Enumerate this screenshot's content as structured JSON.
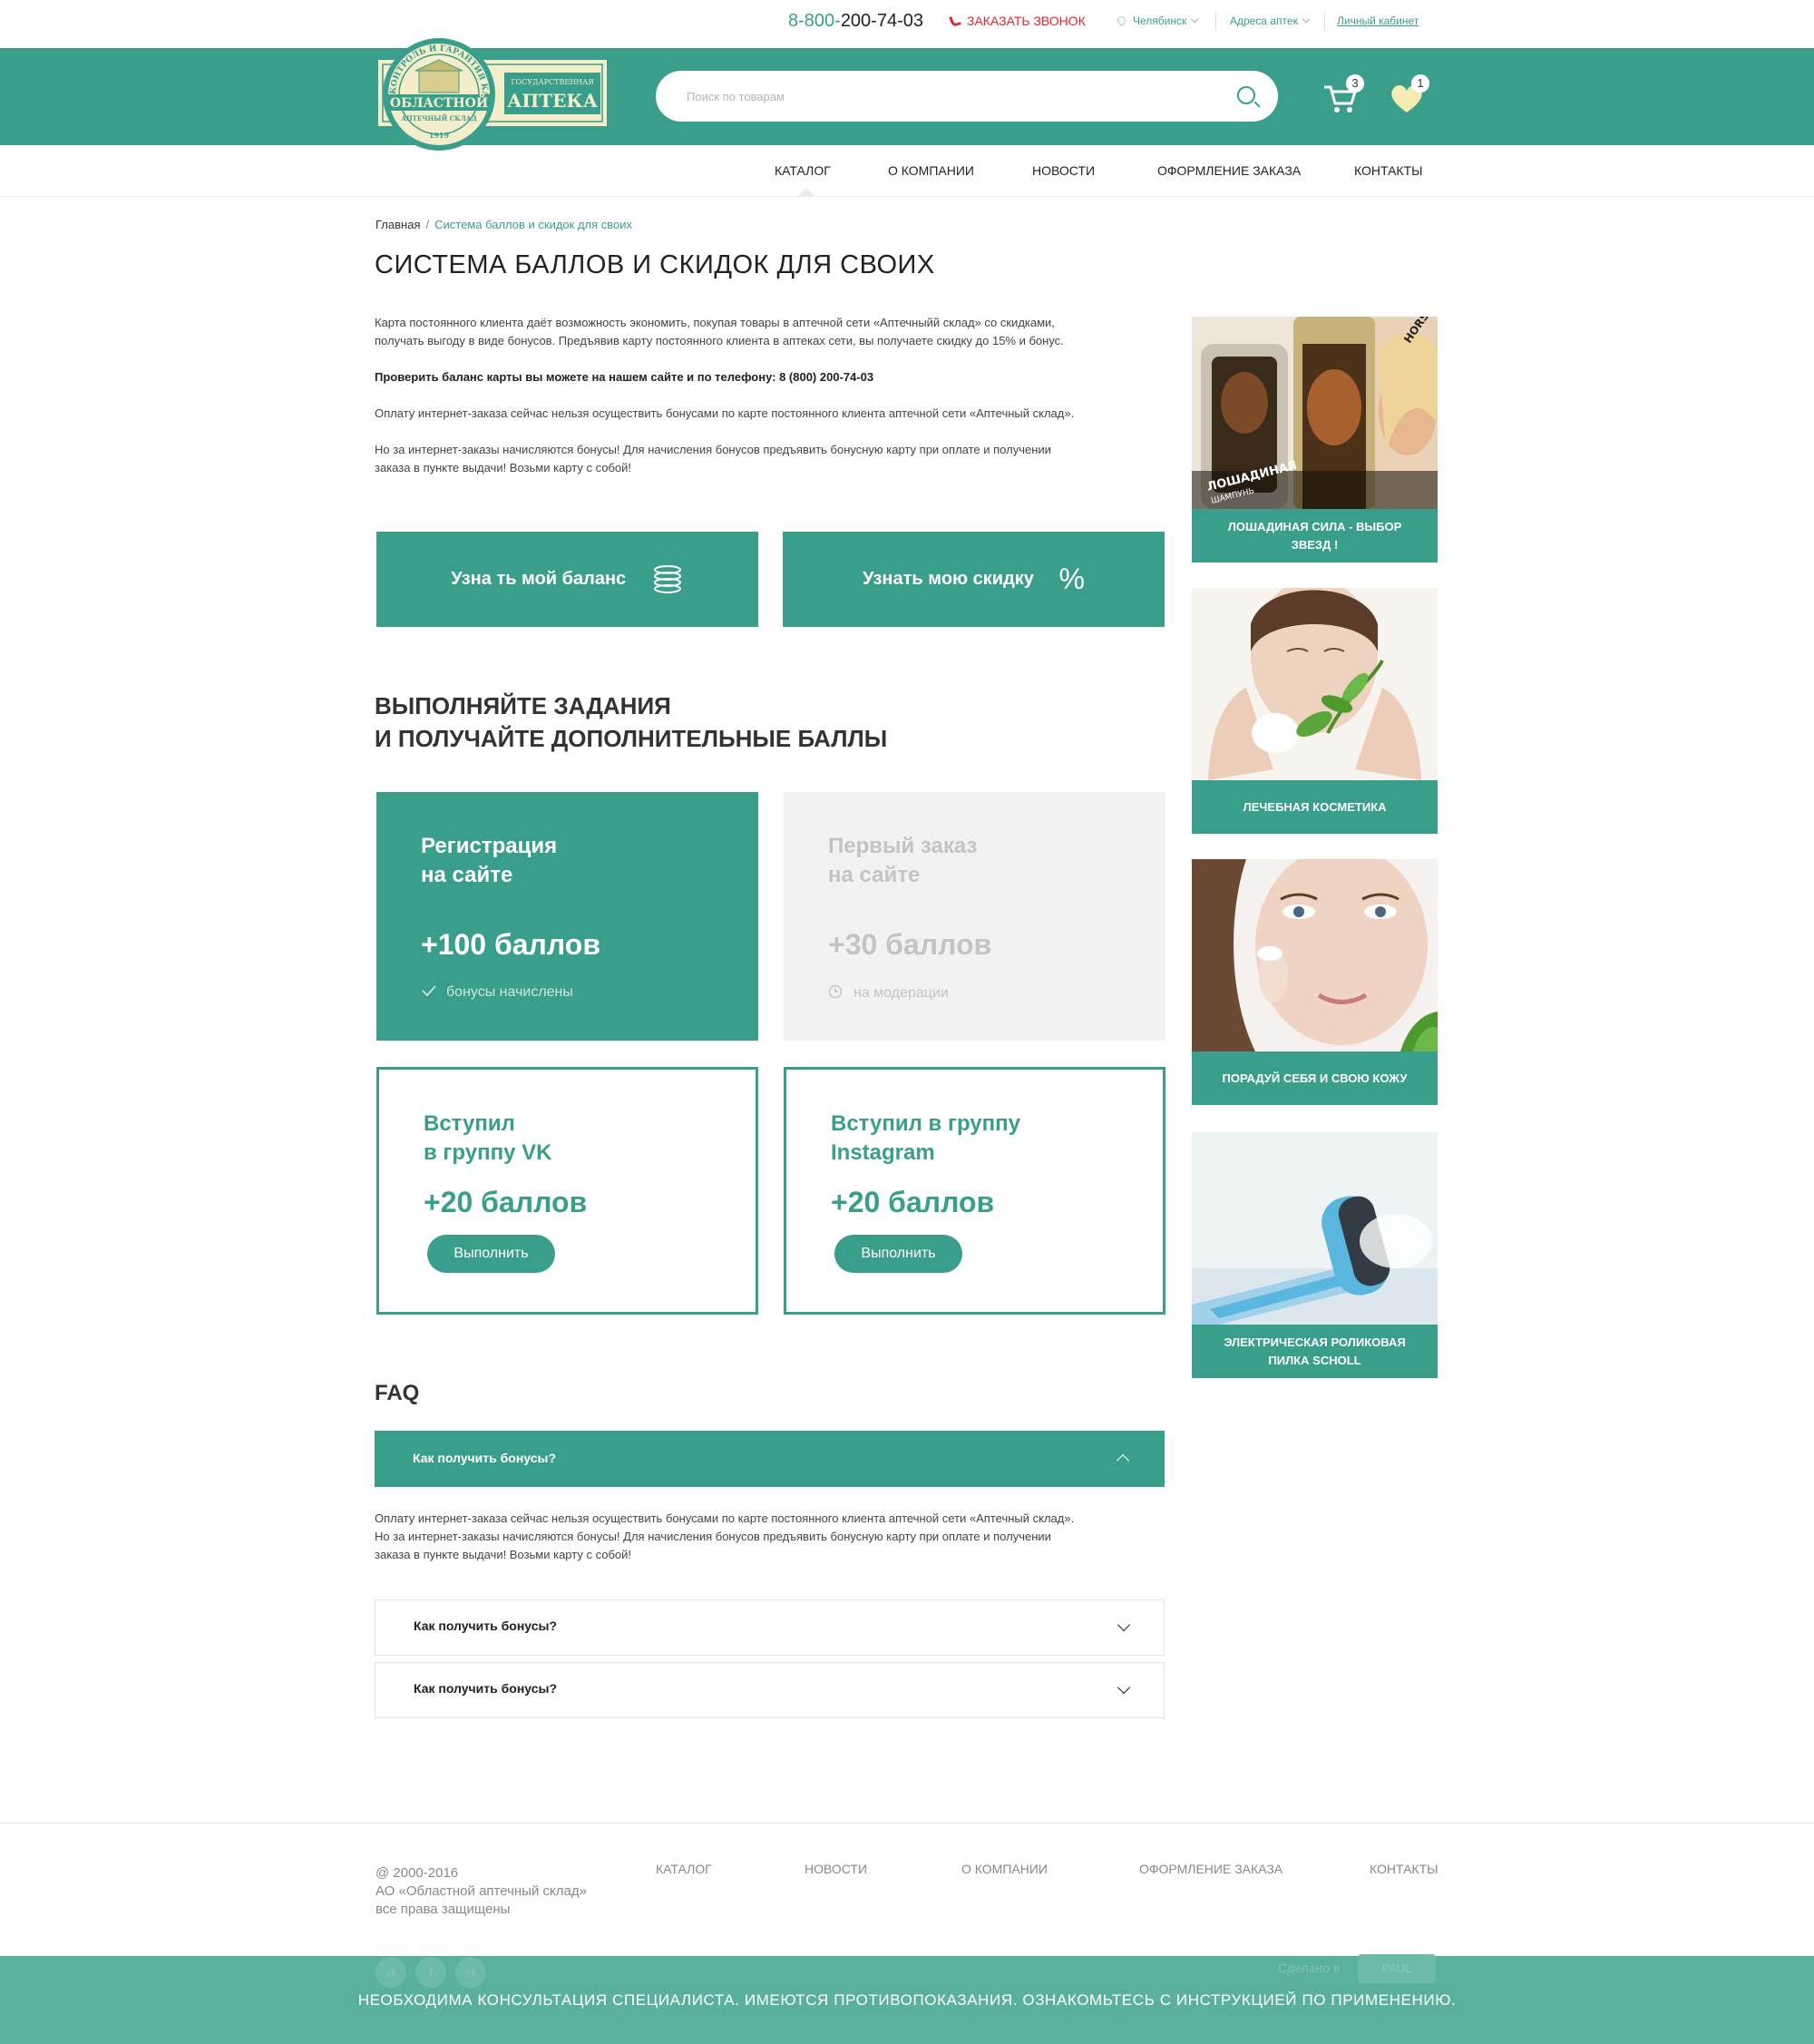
{
  "topbar": {
    "phone_prefix": "8-800-",
    "phone_rest": "200-74-03",
    "callback": "ЗАКАЗАТЬ ЗВОНОК",
    "city": "Челябинск",
    "addresses": "Адреса аптек",
    "cabinet": "Личный кабинет"
  },
  "header": {
    "search_placeholder": "Поиск по товарам",
    "cart_count": "3",
    "fav_count": "1",
    "colors": {
      "accent": "#3a9e8c",
      "danger": "#e0262c"
    },
    "logo": {
      "ring_text": "КОНТРОЛЬ И ГАРАНТИЯ КАЧЕСТВА",
      "ribbon": "ОБЛАСТНОЙ",
      "sub": "АПТЕЧНЫЙ СКЛАД",
      "year": "1919",
      "state": "ГОСУДАРСТВЕННАЯ",
      "pharmacy": "АПТЕКА"
    }
  },
  "nav": {
    "items": [
      "КАТАЛОГ",
      "О КОМПАНИИ",
      "НОВОСТИ",
      "ОФОРМЛЕНИЕ ЗАКАЗА",
      "КОНТАКТЫ"
    ]
  },
  "breadcrumb": {
    "home": "Главная",
    "current": "Система баллов и скидок для своих"
  },
  "page": {
    "title": "СИСТЕМА БАЛЛОВ И СКИДОК ДЛЯ СВОИХ",
    "p1_line1": "Карта постоянного клиента даёт возможность экономить, покупая товары в аптечной сети «Аптечныйй склад» со скидками,",
    "p1_line2": "получать выгоду в виде бонусов. Предъявив карту постоянного клиента в аптеках сети, вы получаете скидку до 15% и бонус.",
    "p2": "Проверить баланс карты вы можете на нашем сайте и по телефону: 8 (800) 200-74-03",
    "p3": "Оплату интернет-заказа сейчас нельзя осуществить бонусами по карте постоянного клиента аптечной сети «Аптечный склад».",
    "p4_line1": "Но за интернет-заказы начисляются бонусы! Для начисления бонусов предъявить бонусную карту при оплате и получении",
    "p4_line2": "заказа в пункте выдачи! Возьми карту с собой!"
  },
  "actions": {
    "balance": "Узна ть мой баланс",
    "discount": "Узнать мою скидку",
    "percent": "%"
  },
  "tasks": {
    "heading_line1": "ВЫПОЛНЯЙТЕ ЗАДАНИЯ",
    "heading_line2": "И ПОЛУЧАЙТЕ ДОПОЛНИТЕЛЬНЫЕ БАЛЛЫ",
    "items": [
      {
        "title_line1": "Регистрация",
        "title_line2": "на сайте",
        "points": "+100 баллов",
        "status": "бонусы начислены"
      },
      {
        "title_line1": "Первый заказ",
        "title_line2": "на сайте",
        "points": "+30 баллов",
        "status": "на модерации"
      },
      {
        "title_line1": "Вступил",
        "title_line2": "в группу VK",
        "points": "+20 баллов",
        "button": "Выполнить"
      },
      {
        "title_line1": "Вступил в группу",
        "title_line2": "Instagram",
        "points": "+20 баллов",
        "button": "Выполнить"
      }
    ]
  },
  "faq": {
    "heading": "FAQ",
    "items": [
      {
        "question": "Как получить бонусы?",
        "open": true
      },
      {
        "question": "Как получить бонусы?",
        "open": false
      },
      {
        "question": "Как получить бонусы?",
        "open": false
      }
    ],
    "answer_line1": "Оплату интернет-заказа сейчас нельзя осуществить бонусами по карте постоянного клиента аптечной сети «Аптечный склад».",
    "answer_line2": "Но за интернет-заказы начисляются бонусы! Для начисления бонусов предъявить бонусную карту при оплате и получении",
    "answer_line3": "заказа в пункте выдачи! Возьми карту с собой!"
  },
  "promos": [
    {
      "caption": "ЛОШАДИНАЯ СИЛА - ВЫБОР ЗВЕЗД !",
      "label": "ЛОШАДИНАЯ",
      "label2": "ШАМПУНЬ",
      "brand": "HORSE FORCE"
    },
    {
      "caption": "ЛЕЧЕБНАЯ КОСМЕТИКА"
    },
    {
      "caption": "ПОРАДУЙ СЕБЯ И СВОЮ КОЖУ"
    },
    {
      "caption": "ЭЛЕКТРИЧЕСКАЯ РОЛИКОВАЯ ПИЛКА SCHOLL"
    }
  ],
  "footer": {
    "copy_line1": "@ 2000-2016",
    "copy_line2": "АО «Областной аптечный склад»",
    "copy_line3": "все права защищены",
    "links": [
      "КАТАЛОГ",
      "НОВОСТИ",
      "О КОМПАНИИ",
      "ОФОРМЛЕНИЕ ЗАКАЗА",
      "КОНТАКТЫ"
    ],
    "social": [
      "vk",
      "f",
      "ok"
    ],
    "made_by": "Сделано в",
    "studio": "PAUL",
    "warning": "НЕОБХОДИМА КОНСУЛЬТАЦИЯ СПЕЦИАЛИСТА. ИМЕЮТСЯ ПРОТИВОПОКАЗАНИЯ. ОЗНАКОМЬТЕСЬ С ИНСТРУКЦИЕЙ ПО ПРИМЕНЕНИЮ."
  }
}
